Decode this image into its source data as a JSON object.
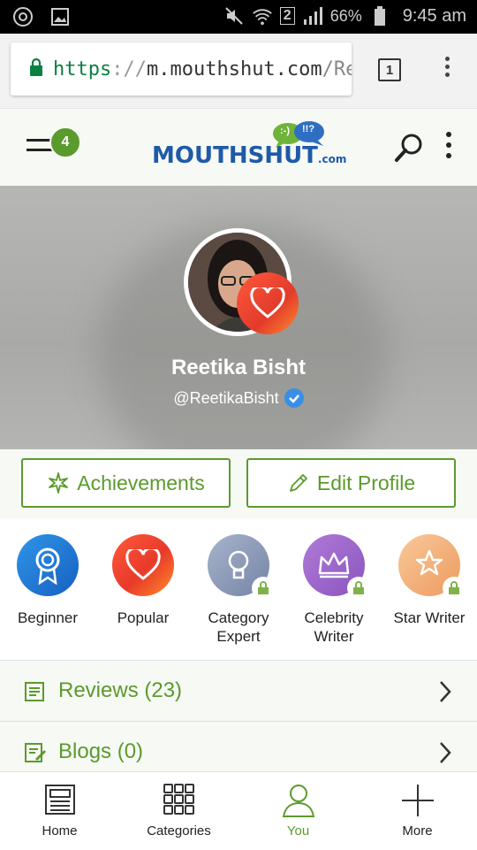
{
  "status_bar": {
    "battery": "66%",
    "time": "9:45 am",
    "sim": "2"
  },
  "browser": {
    "url_scheme": "https",
    "url_sep": "://",
    "url_host": "m.mouthshut.com",
    "url_path": "/Reet",
    "tab_count": "1"
  },
  "header": {
    "menu_badge": "4",
    "logo": "MOUTHSHUT",
    "logo_suffix": ".com",
    "logo_bubble_1": ":-)",
    "logo_bubble_2": "!!?"
  },
  "profile": {
    "name": "Reetika Bisht",
    "handle": "@ReetikaBisht"
  },
  "actions": {
    "achievements": "Achievements",
    "edit_profile": "Edit Profile"
  },
  "badges": [
    {
      "label": "Beginner",
      "locked": false,
      "color": "#1f7fd6"
    },
    {
      "label": "Popular",
      "locked": false,
      "color": "#f0512e"
    },
    {
      "label": "Category Expert",
      "line1": "Category",
      "line2": "Expert",
      "locked": true,
      "color": "#7f8fb0"
    },
    {
      "label": "Celebrity Writer",
      "line1": "Celebrity",
      "line2": "Writer",
      "locked": true,
      "color": "#9b6ac9"
    },
    {
      "label": "Star Writer",
      "locked": true,
      "color": "#f1a468"
    }
  ],
  "lists": {
    "reviews": "Reviews (23)",
    "blogs": "Blogs (0)"
  },
  "nav": {
    "home": "Home",
    "categories": "Categories",
    "you": "You",
    "more": "More"
  },
  "colors": {
    "accent": "#5b9a2d",
    "brand_blue": "#1e5aa8"
  }
}
